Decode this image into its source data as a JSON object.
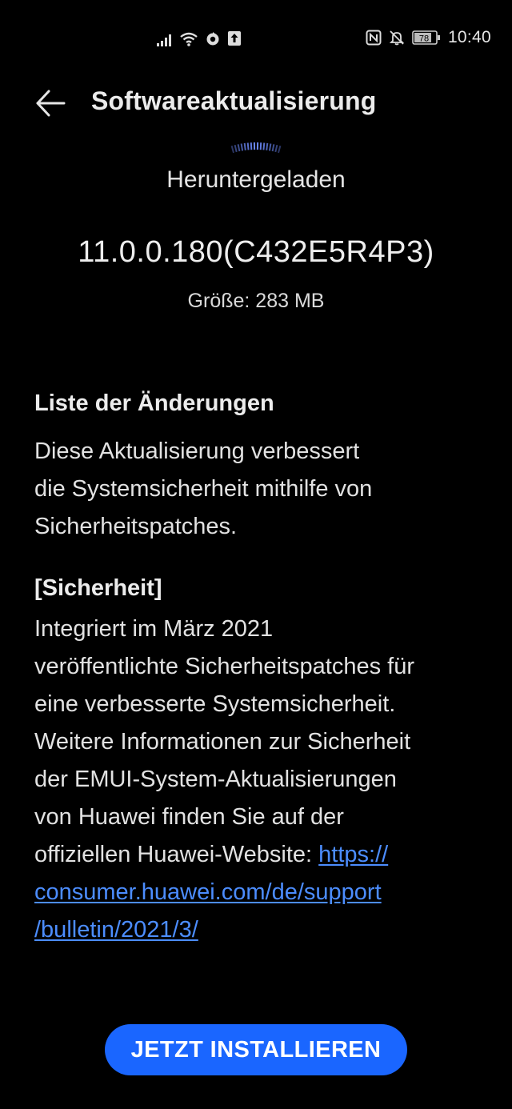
{
  "status_bar": {
    "time": "10:40",
    "battery_level": "78",
    "icons": [
      "signal-icon",
      "wifi-icon",
      "data-saver-icon",
      "upload-icon",
      "nfc-icon",
      "bell-off-icon",
      "battery-icon"
    ]
  },
  "header": {
    "back_icon": "arrow-left-icon",
    "title": "Softwareaktualisierung"
  },
  "update": {
    "status": "Heruntergeladen",
    "version": "11.0.0.180(C432E5R4P3)",
    "size": "Größe: 283 MB",
    "progress_indicator": "arc-icon"
  },
  "changelog": {
    "heading": "Liste der Änderungen",
    "intro_lines": [
      "Diese Aktualisierung verbessert",
      "die Systemsicherheit mithilfe von",
      "Sicherheitspatches."
    ],
    "security_heading": "[Sicherheit]",
    "security_lines": [
      "Integriert im März 2021",
      "veröffentlichte Sicherheitspatches für",
      "eine verbesserte Systemsicherheit.",
      "Weitere Informationen zur Sicherheit",
      "der EMUI-System-Aktualisierungen",
      "von Huawei finden Sie auf der"
    ],
    "link_prefix": "offiziellen Huawei-Website: ",
    "link_lines": [
      "https://",
      "consumer.huawei.com/de/support",
      "/bulletin/2021/3/"
    ]
  },
  "actions": {
    "install_label": "JETZT INSTALLIEREN"
  },
  "colors": {
    "background": "#000000",
    "accent": "#1a66ff",
    "link": "#4c8dff",
    "text": "#e8e8e8"
  }
}
